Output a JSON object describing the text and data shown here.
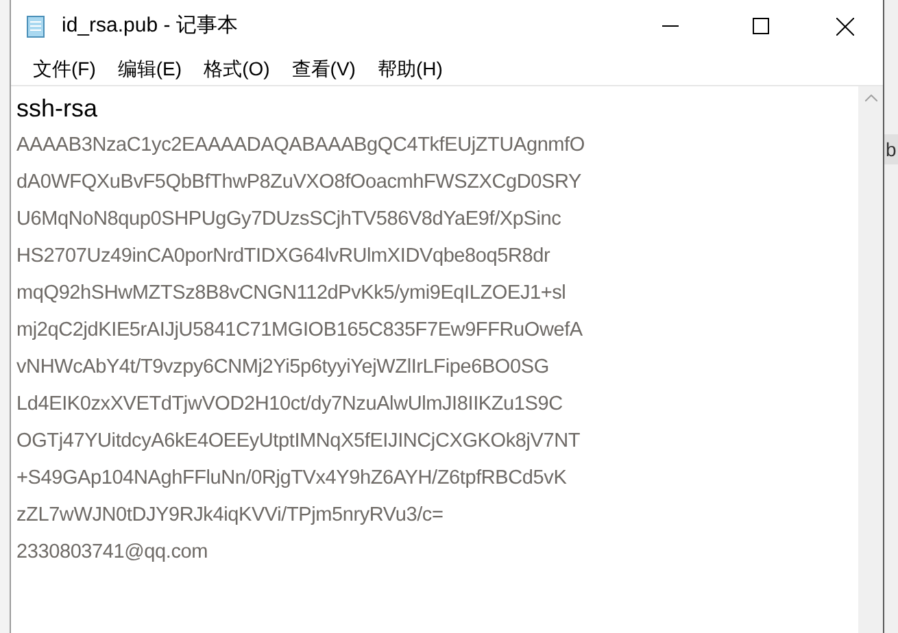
{
  "window": {
    "title": "id_rsa.pub - 记事本"
  },
  "menu": [
    "文件(F)",
    "编辑(E)",
    "格式(O)",
    "查看(V)",
    "帮助(H)"
  ],
  "document": {
    "lines": [
      "ssh-rsa",
      "AAAAB3NzaC1yc2EAAAADAQABAAABgQC4TkfEUjZTUAgnmfO",
      "dA0WFQXuBvF5QbBfThwP8ZuVXO8fOoacmhFWSZXCgD0SRY",
      "U6MqNoN8qup0SHPUgGy7DUzsSCjhTV586V8dYaE9f/XpSinc",
      "HS2707Uz49inCA0porNrdTIDXG64lvRUlmXIDVqbe8oq5R8dr",
      "mqQ92hSHwMZTSz8B8vCNGN112dPvKk5/ymi9EqILZOEJ1+sl",
      "mj2qC2jdKIE5rAIJjU5841C71MGIOB165C835F7Ew9FFRuOwefA",
      "vNHWcAbY4t/T9vzpy6CNMj2Yi5p6tyyiYejWZlIrLFipe6BO0SG",
      "Ld4EIK0zxXVETdTjwVOD2H10ct/dy7NzuAlwUlmJI8IIKZu1S9C",
      "OGTj47YUitdcyA6kE4OEEyUtptIMNqX5fEIJINCjCXGKOk8jV7NT",
      "+S49GAp104NAghFFluNn/0RjgTVx4Y9hZ6AYH/Z6tpfRBCd5vK",
      "zZL7wWJN0tDJY9RJk4iqKVVi/TPjm5nryRVu3/c=",
      "2330803741@qq.com"
    ]
  },
  "background_window": {
    "text": "b"
  }
}
